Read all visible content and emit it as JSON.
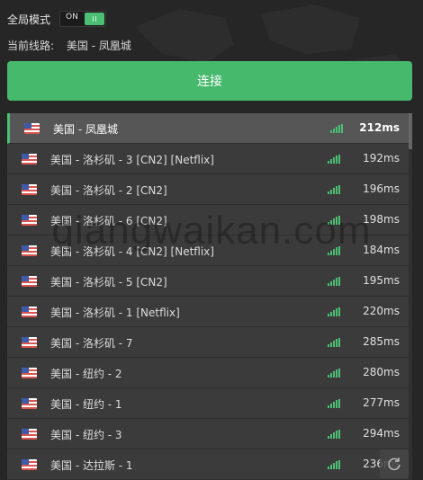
{
  "header": {
    "global_mode_label": "全局模式",
    "toggle_state": "ON",
    "current_route_label": "当前线路:",
    "current_route_value": "美国 - 凤凰城"
  },
  "connect_button_label": "连接",
  "watermark_text": "qiangwaikan.com",
  "colors": {
    "accent": "#47b96d",
    "background": "#262626",
    "row": "#3b3b3b",
    "row_selected": "#565656"
  },
  "servers": [
    {
      "flag_icon": "us-flag-icon",
      "name": "美国 - 凤凰城",
      "latency": "212ms",
      "selected": true
    },
    {
      "flag_icon": "us-flag-icon",
      "name": "美国 - 洛杉矶 - 3 [CN2] [Netflix]",
      "latency": "192ms"
    },
    {
      "flag_icon": "us-flag-icon",
      "name": "美国 - 洛杉矶 - 2 [CN2]",
      "latency": "196ms"
    },
    {
      "flag_icon": "us-flag-icon",
      "name": "美国 - 洛杉矶 - 6 [CN2]",
      "latency": "198ms"
    },
    {
      "flag_icon": "us-flag-icon",
      "name": "美国 - 洛杉矶 - 4 [CN2] [Netflix]",
      "latency": "184ms"
    },
    {
      "flag_icon": "us-flag-icon",
      "name": "美国 - 洛杉矶 - 5 [CN2]",
      "latency": "195ms"
    },
    {
      "flag_icon": "us-flag-icon",
      "name": "美国 - 洛杉矶 - 1 [Netflix]",
      "latency": "220ms"
    },
    {
      "flag_icon": "us-flag-icon",
      "name": "美国 - 洛杉矶 - 7",
      "latency": "285ms"
    },
    {
      "flag_icon": "us-flag-icon",
      "name": "美国 - 纽约 - 2",
      "latency": "280ms"
    },
    {
      "flag_icon": "us-flag-icon",
      "name": "美国 - 纽约 - 1",
      "latency": "277ms"
    },
    {
      "flag_icon": "us-flag-icon",
      "name": "美国 - 纽约 - 3",
      "latency": "294ms"
    },
    {
      "flag_icon": "us-flag-icon",
      "name": "美国 - 达拉斯 - 1",
      "latency": "236ms"
    }
  ]
}
